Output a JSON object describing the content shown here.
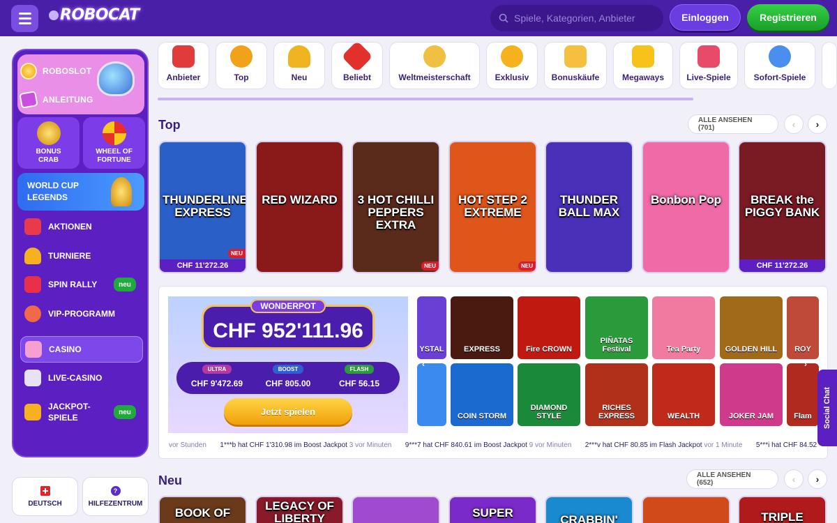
{
  "header": {
    "logo": "ROBOCAT",
    "search_placeholder": "Spiele, Kategorien, Anbieter",
    "login": "Einloggen",
    "register": "Registrieren"
  },
  "sidebar": {
    "roboslot": "ROBOSLOT",
    "guide": "ANLEITUNG",
    "bonus_crab": "BONUS CRAB",
    "wheel": "WHEEL OF FORTUNE",
    "worldcup": "WORLD CUP LEGENDS",
    "items": [
      {
        "label": "AKTIONEN"
      },
      {
        "label": "TURNIERE"
      },
      {
        "label": "SPIN RALLY",
        "badge": "neu"
      },
      {
        "label": "VIP-PROGRAMM"
      },
      {
        "label": "CASINO"
      },
      {
        "label": "LIVE-CASINO"
      },
      {
        "label": "JACKPOT-SPIELE",
        "badge": "neu"
      }
    ],
    "language": "DEUTSCH",
    "help": "HILFEZENTRUM"
  },
  "categories": [
    {
      "label": "Anbieter",
      "color": "#e23b3b"
    },
    {
      "label": "Top",
      "color": "#f2a21a"
    },
    {
      "label": "Neu",
      "color": "#f0b420"
    },
    {
      "label": "Beliebt",
      "color": "#e2302a"
    },
    {
      "label": "Weltmeisterschaft",
      "color": "#f0c040"
    },
    {
      "label": "Exklusiv",
      "color": "#f5b21e"
    },
    {
      "label": "Bonuskäufe",
      "color": "#f5c040"
    },
    {
      "label": "Megaways",
      "color": "#f7c21a"
    },
    {
      "label": "Live-Spiele",
      "color": "#e84a6a"
    },
    {
      "label": "Sofort-Spiele",
      "color": "#4a8ef0"
    }
  ],
  "top": {
    "title": "Top",
    "see_all": "ALLE ANSEHEN (701)",
    "games": [
      {
        "title": "THUNDERLINE EXPRESS",
        "bg": "#2a5fc8",
        "price": "CHF 11'272.26",
        "badge": "NEU"
      },
      {
        "title": "RED WIZARD",
        "bg": "#8a1a1a",
        "price": "",
        "badge": ""
      },
      {
        "title": "3 HOT CHILLI PEPPERS EXTRA",
        "bg": "#5a2a1a",
        "price": "",
        "badge": "NEU"
      },
      {
        "title": "HOT STEP 2 EXTREME",
        "bg": "#e0561a",
        "price": "",
        "badge": "NEU"
      },
      {
        "title": "THUNDER BALL MAX",
        "bg": "#4a2fb8",
        "price": "",
        "badge": ""
      },
      {
        "title": "Bonbon Pop",
        "bg": "#f06aa8",
        "price": "",
        "badge": ""
      },
      {
        "title": "BREAK the PIGGY BANK",
        "bg": "#7a1a22",
        "price": "CHF 11'272.26",
        "badge": ""
      }
    ]
  },
  "jackpot": {
    "name": "WONDERPOT",
    "amount": "CHF 952'111.96",
    "tiers": [
      {
        "label": "ULTRA",
        "value": "CHF 9'472.69",
        "color": "#b33aa0"
      },
      {
        "label": "BOOST",
        "value": "CHF 805.00",
        "color": "#2f5fd0"
      },
      {
        "label": "FLASH",
        "value": "CHF 56.15",
        "color": "#2e9a40"
      }
    ],
    "play": "Jetzt spielen",
    "ticker": [
      {
        "text": "",
        "meta": "vor Stunden"
      },
      {
        "text": "1***b hat CHF 1'310.98 im Boost Jackpot",
        "meta": "3 vor Minuten"
      },
      {
        "text": "9***7 hat CHF 840.61 im Boost Jackpot",
        "meta": "9 vor Minuten"
      },
      {
        "text": "2***v hat CHF 80.85 im Flash Jackpot",
        "meta": "vor 1 Minute"
      },
      {
        "text": "5***i hat CHF 84.52",
        "meta": ""
      }
    ],
    "games_top": [
      {
        "title": "YSTAL",
        "bg": "#6a3fd6"
      },
      {
        "title": "EXPRESS",
        "bg": "#4a1a10"
      },
      {
        "title": "Fire CROWN",
        "bg": "#c01a10"
      },
      {
        "title": "PIÑATAS Festival",
        "bg": "#2a9a3a"
      },
      {
        "title": "Tea Party",
        "bg": "#f07aa0"
      },
      {
        "title": "GOLDEN HILL",
        "bg": "#a06a1a"
      },
      {
        "title": "ROY",
        "bg": "#c04a3a"
      }
    ],
    "games_bottom": [
      {
        "title": "",
        "bg": "#3a8af0"
      },
      {
        "title": "COIN STORM",
        "bg": "#1a6ad0"
      },
      {
        "title": "DIAMOND STYLE",
        "bg": "#1a8a3a"
      },
      {
        "title": "RICHES EXPRESS",
        "bg": "#b0301a"
      },
      {
        "title": "WEALTH",
        "bg": "#c02a1a"
      },
      {
        "title": "JOKER JAM",
        "bg": "#d03a8a"
      },
      {
        "title": "Flam",
        "bg": "#b02a20"
      }
    ]
  },
  "neu": {
    "title": "Neu",
    "see_all": "ALLE ANSEHEN (652)",
    "games": [
      {
        "title": "BOOK OF",
        "bg": "#6a3a1a"
      },
      {
        "title": "LEGACY OF LIBERTY",
        "bg": "#8a1a2a"
      },
      {
        "title": "",
        "bg": "#a04ad0"
      },
      {
        "title": "SUPER",
        "bg": "#7a2ac8"
      },
      {
        "title": "CRABBIN'",
        "bg": "#1a8ad0"
      },
      {
        "title": "",
        "bg": "#d04a1a"
      },
      {
        "title": "TRIPLE",
        "bg": "#b01a1a"
      }
    ]
  },
  "social_chat": "Social Chat"
}
